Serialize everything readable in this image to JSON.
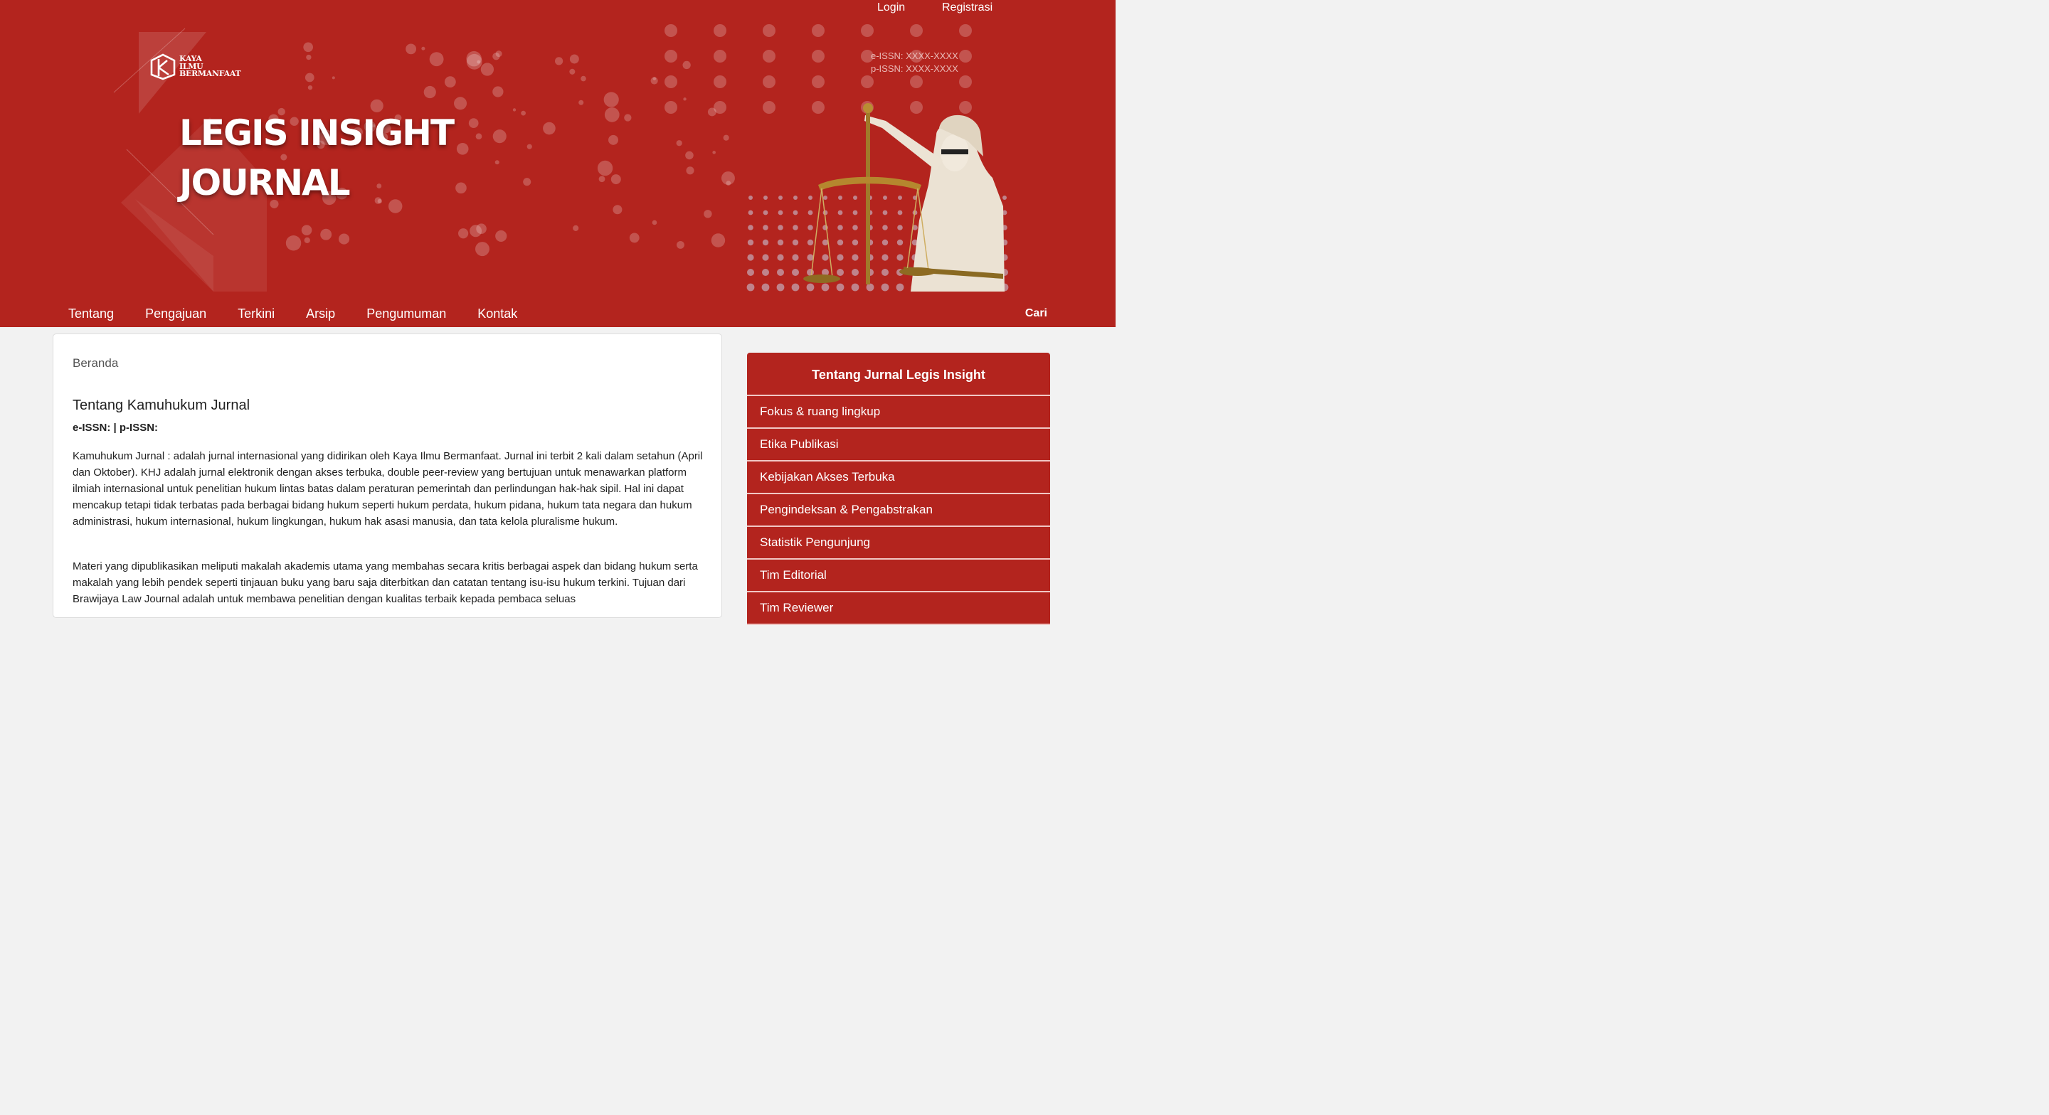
{
  "header": {
    "user_nav": {
      "login": "Login",
      "register": "Registrasi"
    },
    "logo_text": [
      "KAYA",
      "ILMU",
      "BERMANFAAT"
    ],
    "title_line1": "LEGIS INSIGHT",
    "title_line2": "JOURNAL",
    "e_issn": "e-ISSN: XXXX-XXXX",
    "p_issn": "p-ISSN: XXXX-XXXX",
    "primary_nav": [
      "Tentang",
      "Pengajuan",
      "Terkini",
      "Arsip",
      "Pengumuman",
      "Kontak"
    ],
    "search_label": "Cari"
  },
  "main": {
    "breadcrumb": "Beranda",
    "about_title": "Tentang Kamuhukum Jurnal",
    "issn_line": "e-ISSN: | p-ISSN:",
    "paragraph1": "Kamuhukum Jurnal : adalah jurnal internasional yang didirikan oleh Kaya Ilmu Bermanfaat. Jurnal ini terbit 2 kali dalam setahun (April dan Oktober). KHJ adalah jurnal elektronik dengan akses terbuka, double peer-review yang bertujuan untuk menawarkan platform ilmiah internasional untuk penelitian hukum lintas batas dalam peraturan pemerintah dan perlindungan hak-hak sipil. Hal ini dapat mencakup tetapi tidak terbatas pada berbagai bidang hukum seperti hukum perdata, hukum pidana, hukum tata negara dan hukum administrasi, hukum internasional, hukum lingkungan, hukum hak asasi manusia, dan tata kelola pluralisme hukum.",
    "paragraph2": "Materi yang dipublikasikan meliputi makalah akademis utama yang membahas secara kritis berbagai aspek dan bidang hukum serta makalah yang lebih pendek seperti tinjauan buku yang baru saja diterbitkan dan catatan tentang isu-isu hukum terkini. Tujuan dari Brawijaya Law Journal adalah untuk membawa penelitian dengan kualitas terbaik kepada pembaca seluas"
  },
  "sidebar": {
    "title": "Tentang Jurnal Legis Insight",
    "items": [
      "Fokus & ruang lingkup",
      "Etika Publikasi",
      "Kebijakan Akses Terbuka",
      "Pengindeksan & Pengabstrakan",
      "Statistik Pengunjung",
      "Tim Editorial",
      "Tim Reviewer"
    ]
  },
  "colors": {
    "brand_red": "#b3241e",
    "separator_pink": "#f1c7c4"
  },
  "icons": [
    "logo-mark-icon",
    "scales-of-justice-icon"
  ]
}
